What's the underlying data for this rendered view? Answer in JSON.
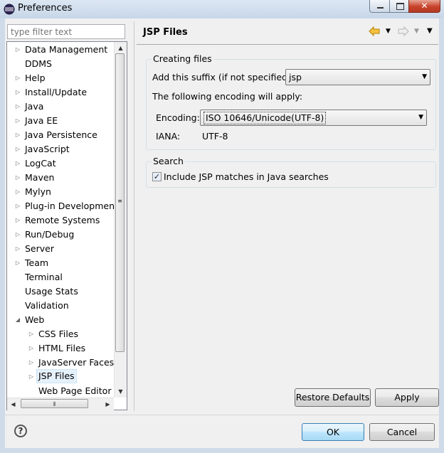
{
  "window": {
    "title": "Preferences"
  },
  "filter": {
    "placeholder": "type filter text",
    "value": ""
  },
  "tree": {
    "items": [
      {
        "label": "Data Management",
        "expanded": false,
        "level": 0,
        "has_children": true
      },
      {
        "label": "DDMS",
        "level": 0,
        "has_children": false
      },
      {
        "label": "Help",
        "level": 0,
        "has_children": true
      },
      {
        "label": "Install/Update",
        "level": 0,
        "has_children": true
      },
      {
        "label": "Java",
        "level": 0,
        "has_children": true
      },
      {
        "label": "Java EE",
        "level": 0,
        "has_children": true
      },
      {
        "label": "Java Persistence",
        "level": 0,
        "has_children": true
      },
      {
        "label": "JavaScript",
        "level": 0,
        "has_children": true
      },
      {
        "label": "LogCat",
        "level": 0,
        "has_children": true
      },
      {
        "label": "Maven",
        "level": 0,
        "has_children": true
      },
      {
        "label": "Mylyn",
        "level": 0,
        "has_children": true
      },
      {
        "label": "Plug-in Development",
        "level": 0,
        "has_children": true
      },
      {
        "label": "Remote Systems",
        "level": 0,
        "has_children": true
      },
      {
        "label": "Run/Debug",
        "level": 0,
        "has_children": true
      },
      {
        "label": "Server",
        "level": 0,
        "has_children": true
      },
      {
        "label": "Team",
        "level": 0,
        "has_children": true
      },
      {
        "label": "Terminal",
        "level": 0,
        "has_children": false
      },
      {
        "label": "Usage Stats",
        "level": 0,
        "has_children": false
      },
      {
        "label": "Validation",
        "level": 0,
        "has_children": false
      },
      {
        "label": "Web",
        "level": 0,
        "has_children": true,
        "expanded": true
      },
      {
        "label": "CSS Files",
        "level": 1,
        "has_children": true
      },
      {
        "label": "HTML Files",
        "level": 1,
        "has_children": true
      },
      {
        "label": "JavaServer Faces T",
        "level": 1,
        "has_children": true
      },
      {
        "label": "JSP Files",
        "level": 1,
        "has_children": true,
        "selected": true
      },
      {
        "label": "Web Page Editor",
        "level": 1,
        "has_children": false
      }
    ]
  },
  "page": {
    "title": "JSP Files",
    "creating_group": {
      "legend": "Creating files",
      "suffix_label": "Add this suffix (if not specified):",
      "suffix_value": "jsp",
      "encoding_intro": "The following encoding will apply:",
      "encoding_label": "Encoding:",
      "encoding_value": "ISO 10646/Unicode(UTF-8)",
      "iana_label": "IANA:",
      "iana_value": "UTF-8"
    },
    "search_group": {
      "legend": "Search",
      "include_label": "Include JSP matches in Java searches",
      "include_checked": true
    },
    "restore_label": "Restore Defaults",
    "apply_label": "Apply"
  },
  "footer": {
    "ok_label": "OK",
    "cancel_label": "Cancel"
  },
  "icons": {
    "app": "eclipse-icon",
    "help": "help-icon",
    "back": "back-arrow-icon",
    "forward": "forward-arrow-icon",
    "menu": "view-menu-icon"
  },
  "colors": {
    "nav_back": "#e0a000",
    "titlebar": "#dce7f3",
    "close": "#c8412a"
  }
}
